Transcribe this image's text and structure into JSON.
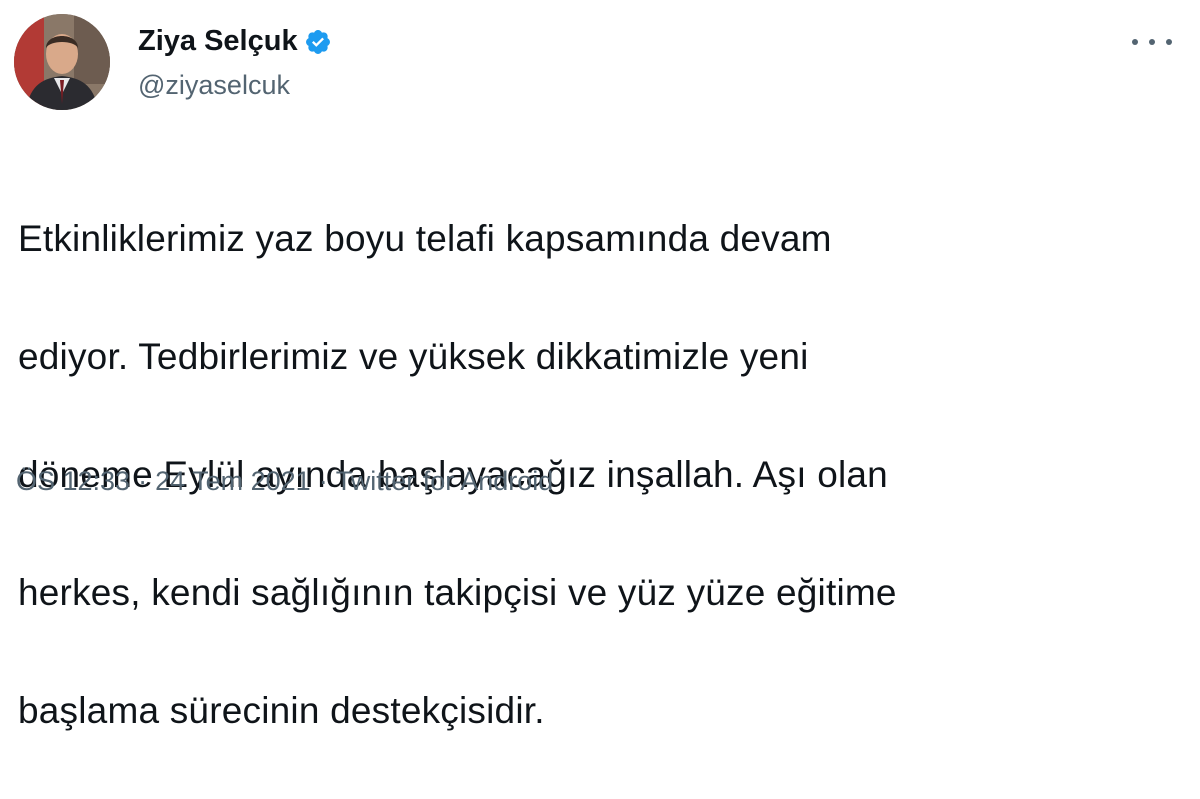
{
  "author": {
    "display_name": "Ziya Selçuk",
    "handle": "@ziyaselcuk",
    "verified": true
  },
  "tweet": {
    "lines": [
      "Etkinliklerimiz yaz boyu telafi kapsamında devam",
      "ediyor. Tedbirlerimiz ve yüksek dikkatimizle yeni",
      "döneme Eylül ayında başlayacağız inşallah. Aşı olan",
      "herkes, kendi sağlığının takipçisi ve yüz yüze eğitime",
      "başlama sürecinin destekçisidir."
    ]
  },
  "meta": {
    "time": "ÖS 12:33",
    "date": "24 Tem 2021",
    "source": "Twitter for Android",
    "separator": "·"
  },
  "icons": {
    "verified": "verified-badge-icon",
    "more": "more-options-icon"
  },
  "colors": {
    "verified_blue": "#1d9bf0",
    "text_primary": "#0f1419",
    "text_secondary": "#536471"
  }
}
